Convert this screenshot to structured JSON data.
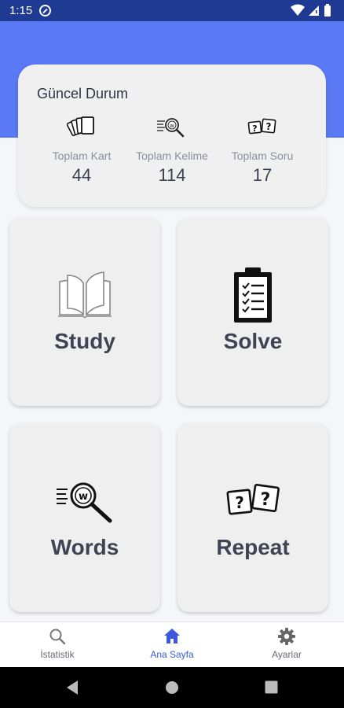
{
  "status_bar": {
    "time": "1:15"
  },
  "summary": {
    "title": "Güncel Durum",
    "stats": [
      {
        "label": "Toplam Kart",
        "value": "44",
        "icon": "cards-icon"
      },
      {
        "label": "Toplam Kelime",
        "value": "114",
        "icon": "word-search-icon"
      },
      {
        "label": "Toplam Soru",
        "value": "17",
        "icon": "question-cards-icon"
      }
    ]
  },
  "tiles": {
    "study": {
      "label": "Study",
      "icon": "book-icon"
    },
    "solve": {
      "label": "Solve",
      "icon": "clipboard-checklist-icon"
    },
    "words": {
      "label": "Words",
      "icon": "word-search-icon"
    },
    "repeat": {
      "label": "Repeat",
      "icon": "question-cards-icon"
    }
  },
  "nav": {
    "items": [
      {
        "label": "İstatistik",
        "icon": "search-icon"
      },
      {
        "label": "Ana Sayfa",
        "icon": "home-icon"
      },
      {
        "label": "Ayarlar",
        "icon": "gear-icon"
      }
    ],
    "active_index": 1
  },
  "colors": {
    "status_bar": "#1f3a93",
    "hero": "#5a79f4",
    "accent": "#3b5bdb",
    "tile_bg": "#efefef",
    "text_dark": "#3f4454"
  }
}
